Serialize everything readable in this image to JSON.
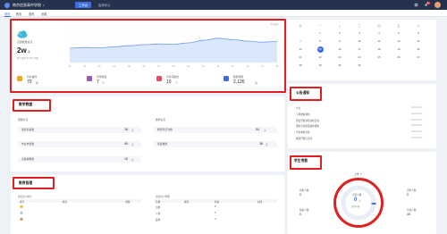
{
  "topbar": {
    "school_name": "南京信息高中学校",
    "tabs": [
      {
        "label": "工作台"
      },
      {
        "label": "应用中心"
      }
    ],
    "notification_count": "1"
  },
  "subnav": {
    "tabs": [
      {
        "label": "首页"
      },
      {
        "label": "教务"
      },
      {
        "label": "德育"
      },
      {
        "label": "设置"
      }
    ]
  },
  "overview": {
    "title": "应用数量总览",
    "value": "2w",
    "unit": "条",
    "subtitle": "累计使用 80,367 次数",
    "legend": "平均使用",
    "chart_ticks": [
      "01",
      "02",
      "03",
      "04",
      "05",
      "06",
      "07",
      "08",
      "09",
      "10",
      "11",
      "12",
      "13",
      "14",
      "15"
    ],
    "stats": [
      {
        "value": "70",
        "unit": "件",
        "label": "待办事件",
        "color": "#f5a623"
      },
      {
        "value": "7",
        "unit": "个",
        "label": "待审批数",
        "color": "#9b59b6"
      },
      {
        "value": "10",
        "unit": "个",
        "label": "待查阅报告",
        "color": "#e84c5f"
      },
      {
        "value": "2,126",
        "unit": "次",
        "label": "数据调用",
        "color": "#3b6fe0"
      }
    ]
  },
  "chart_data": {
    "type": "area",
    "x": [
      "01",
      "02",
      "03",
      "04",
      "05",
      "06",
      "07",
      "08",
      "09",
      "10",
      "11",
      "12",
      "13",
      "14",
      "15"
    ],
    "series": [
      {
        "values": [
          40,
          42,
          41,
          44,
          47,
          50,
          52,
          51,
          55,
          62,
          68,
          64,
          60,
          57,
          59
        ]
      }
    ],
    "ylim": [
      0,
      100
    ],
    "grid": true
  },
  "teaching": {
    "title": "教学数据",
    "left_title": "课程信息",
    "right_title": "教学信息",
    "left_rows": [
      {
        "label": "课表查看数",
        "value": "18",
        "unit": "次"
      },
      {
        "label": "作业布置数",
        "value": "95",
        "unit": "次"
      },
      {
        "label": "直播课程数",
        "value": "15",
        "unit": "次"
      }
    ],
    "right_rows": [
      {
        "label": "教师登录次数",
        "value": "54",
        "unit": "次"
      },
      {
        "label": "答疑数量",
        "value": "36",
        "unit": "次"
      }
    ]
  },
  "edu_mgmt": {
    "title": "教育管理",
    "left_title": "宿舍出入统计",
    "right_title": "宿舍出入明细",
    "left_head": [
      "排行",
      "姓名",
      "次数"
    ],
    "right_head": [
      "名称",
      "类型",
      "状态",
      "时间"
    ],
    "right_rows": [
      {
        "name": "出校",
        "count": "8"
      },
      {
        "name": "入校",
        "count": "6"
      },
      {
        "name": "返校",
        "count": "3"
      }
    ]
  },
  "calendar": {
    "weekdays": [
      "日",
      "一",
      "二",
      "三",
      "四",
      "五",
      "六"
    ],
    "days": [
      "",
      "1",
      "2",
      "3",
      "4",
      "5",
      "6",
      "7",
      "8",
      "9",
      "10",
      "11",
      "12",
      "13",
      "14",
      "15",
      "16",
      "17",
      "18",
      "19",
      "20",
      "21",
      "22",
      "23",
      "24",
      "25",
      "26",
      "27",
      "28",
      "29",
      "30",
      "31"
    ],
    "selected": "15"
  },
  "notices": {
    "title": "公告通知",
    "items": [
      {
        "text": "公告",
        "date": "2023-02-21"
      },
      {
        "text": "下周放假通知",
        "date": "2023-02-21"
      },
      {
        "text": "周四开展消防演练活动",
        "date": "2023-02-21"
      },
      {
        "text": "期末考试成绩发布通知",
        "date": "2023-02-21"
      },
      {
        "text": "学生体检安排",
        "date": "2023-02-21"
      },
      {
        "text": "校园开放日活动",
        "date": "2023-02-21"
      }
    ]
  },
  "attendance": {
    "title": "学生考勤",
    "filter": "上学",
    "total_label": "应到人数",
    "total": "0",
    "total_unit": "人",
    "sub_label": "实到人数",
    "left": [
      {
        "label": "请假人数",
        "value": "0"
      },
      {
        "label": "缺勤人数",
        "value": "0"
      }
    ],
    "right": [
      {
        "label": "迟到人数",
        "value": "0"
      },
      {
        "label": "早退人数",
        "value": "34"
      }
    ]
  }
}
